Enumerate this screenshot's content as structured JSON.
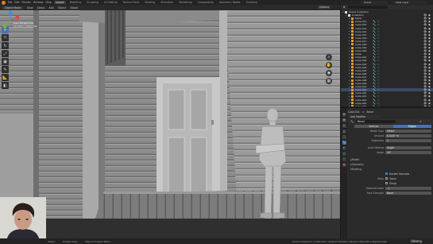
{
  "app": {
    "menu": [
      "File",
      "Edit",
      "Render",
      "Window",
      "Help"
    ],
    "workspaces": [
      "Layout",
      "Modeling",
      "Sculpting",
      "UV Editing",
      "Texture Paint",
      "Shading",
      "Animation",
      "Rendering",
      "Compositing",
      "Geometry Nodes",
      "Scripting"
    ],
    "active_workspace": "Layout",
    "scene": "Scene",
    "view_layer": "View Layer",
    "accent_color": "#4772b3",
    "logo_color": "#e87d0d"
  },
  "viewport_header": {
    "mode": "Object Mode",
    "menus": [
      "View",
      "Select",
      "Add",
      "Object"
    ],
    "orientation": "Global",
    "options_label": "Options"
  },
  "viewport": {
    "info_line1": "User Perspective",
    "info_line2": "(1) Door | Cube.041",
    "tools": [
      "cursor",
      "move",
      "rotate",
      "scale",
      "transform",
      "annotate",
      "measure",
      "add-cube"
    ],
    "active_tool_index": 0
  },
  "outliner": {
    "header": "Scene Collection",
    "rows": [
      {
        "label": "Scene Collection",
        "indent": 0,
        "kind": "root"
      },
      {
        "label": "Collection",
        "indent": 1,
        "kind": "collection"
      },
      {
        "label": "Plane",
        "indent": 2,
        "kind": "object"
      },
      {
        "label": "Cube.011",
        "indent": 2,
        "kind": "object",
        "icons": true
      },
      {
        "label": "Cube.012",
        "indent": 2,
        "kind": "object",
        "icons": true
      },
      {
        "label": "Cube.013",
        "indent": 2,
        "kind": "object",
        "icons": true
      },
      {
        "label": "Cube.014",
        "indent": 2,
        "kind": "object",
        "icons": true
      },
      {
        "label": "Cube.015",
        "indent": 2,
        "kind": "object",
        "icons": true
      },
      {
        "label": "Cube.016",
        "indent": 2,
        "kind": "object",
        "icons": true
      },
      {
        "label": "Cube.017",
        "indent": 2,
        "kind": "object",
        "icons": true
      },
      {
        "label": "Cube.018",
        "indent": 2,
        "kind": "object",
        "icons": true
      },
      {
        "label": "Cube.019",
        "indent": 2,
        "kind": "object",
        "icons": true
      },
      {
        "label": "Cube.020",
        "indent": 2,
        "kind": "object",
        "icons": true
      },
      {
        "label": "Cube",
        "indent": 2,
        "kind": "object",
        "icons": true
      },
      {
        "label": "Cube.001",
        "indent": 2,
        "kind": "object",
        "icons": true
      },
      {
        "label": "Cube.002",
        "indent": 2,
        "kind": "object",
        "icons": true
      },
      {
        "label": "Cube.003",
        "indent": 2,
        "kind": "object",
        "icons": true
      },
      {
        "label": "Cube.004",
        "indent": 2,
        "kind": "object",
        "icons": true
      },
      {
        "label": "Cube.005",
        "indent": 2,
        "kind": "object",
        "icons": true
      },
      {
        "label": "Cube.006",
        "indent": 2,
        "kind": "object",
        "icons": true
      },
      {
        "label": "Cube.007",
        "indent": 2,
        "kind": "object",
        "icons": true
      },
      {
        "label": "Cube.008",
        "indent": 2,
        "kind": "object",
        "icons": true
      },
      {
        "label": "Cube.009",
        "indent": 2,
        "kind": "object",
        "icons": true
      },
      {
        "label": "Cube.010",
        "indent": 2,
        "kind": "object",
        "icons": true
      },
      {
        "label": "Cube.041",
        "indent": 2,
        "kind": "object",
        "icons": true,
        "selected": true
      },
      {
        "label": "Cube.042",
        "indent": 2,
        "kind": "object",
        "icons": true
      },
      {
        "label": "Cube.043",
        "indent": 2,
        "kind": "object",
        "icons": true
      },
      {
        "label": "Cube.044",
        "indent": 2,
        "kind": "object",
        "icons": true
      },
      {
        "label": "Cube.045",
        "indent": 2,
        "kind": "object",
        "icons": true
      },
      {
        "label": "Cube.046",
        "indent": 2,
        "kind": "object",
        "icons": true
      },
      {
        "label": "Cube.047",
        "indent": 2,
        "kind": "object",
        "icons": true
      }
    ]
  },
  "properties": {
    "object_name": "Cube.041",
    "breadcrumb_sep": ">",
    "modifier_target": "Bevel",
    "add_modifier": "Add Modifier",
    "modifier_name": "Bevel",
    "seg_vertices": "Vertices",
    "seg_edges": "Edges",
    "rows": [
      {
        "label": "Width Type",
        "value": "Offset"
      },
      {
        "label": "Amount",
        "value": "0.0167 m"
      },
      {
        "label": "Segments",
        "value": "1"
      }
    ],
    "limit_method_label": "Limit Method",
    "limit_method": "Angle",
    "angle_label": "Angle",
    "angle_value": "30°",
    "panels": [
      "Profile",
      "Geometry",
      "Shading"
    ],
    "harden_normals": "Harden Normals",
    "mark_label": "Mark",
    "mark_seam": "Seam",
    "mark_sharp": "Sharp",
    "material_index_label": "Material Index",
    "material_index_value": "-1",
    "face_strength_label": "Face Strength",
    "face_strength_value": "None"
  },
  "statusbar": {
    "hint1": "Select",
    "hint2": "Rotate View",
    "hint3": "Object Context Menu",
    "stats": "Scene Collection | Cube.041 | Verts:2,734,592 | Faces:1,340,404 | Objects:1/40",
    "watermark": "Udemy"
  }
}
